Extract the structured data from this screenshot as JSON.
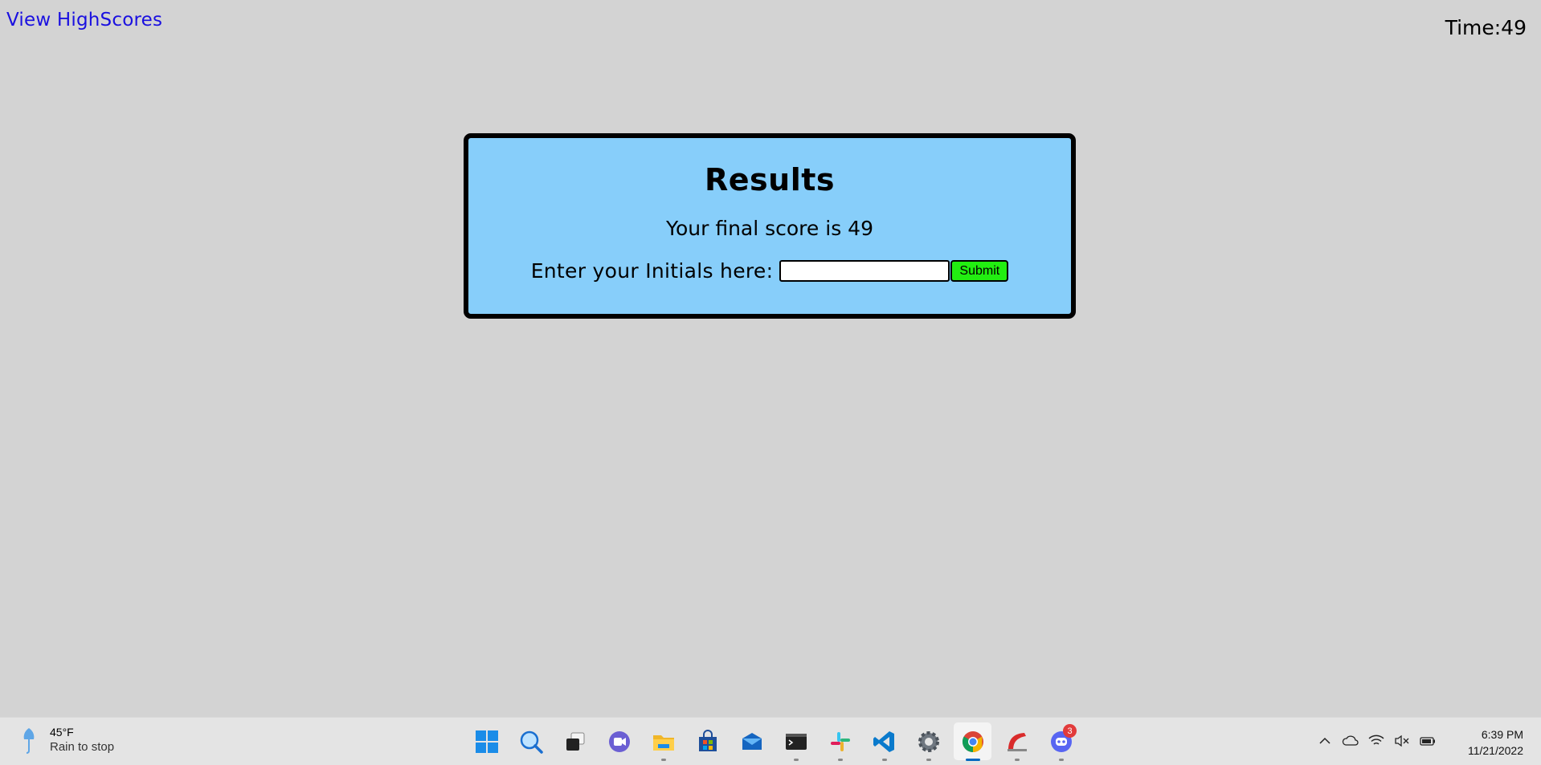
{
  "header": {
    "highscores_link": "View HighScores",
    "timer": "Time:49"
  },
  "results": {
    "title": "Results",
    "final_score_text": "Your final score is 49",
    "initials_label": "Enter your Initials here:",
    "initials_value": "",
    "submit_label": "Submit"
  },
  "taskbar": {
    "weather": {
      "temp": "45°F",
      "desc": "Rain to stop",
      "icon": "umbrella-icon"
    },
    "apps": [
      {
        "name": "start-menu-icon"
      },
      {
        "name": "search-icon"
      },
      {
        "name": "task-view-icon"
      },
      {
        "name": "teams-chat-icon"
      },
      {
        "name": "file-explorer-icon"
      },
      {
        "name": "microsoft-store-icon"
      },
      {
        "name": "mail-icon"
      },
      {
        "name": "terminal-icon"
      },
      {
        "name": "slack-icon"
      },
      {
        "name": "vscode-icon"
      },
      {
        "name": "settings-icon"
      },
      {
        "name": "chrome-icon",
        "active": true
      },
      {
        "name": "app-red-icon"
      },
      {
        "name": "discord-icon",
        "badge": "3"
      }
    ],
    "tray": [
      "chevron-up-icon",
      "onedrive-icon",
      "wifi-icon",
      "volume-muted-icon",
      "battery-icon"
    ],
    "clock": {
      "time": "6:39 PM",
      "date": "11/21/2022"
    }
  },
  "colors": {
    "background": "#d3d3d3",
    "card": "#87cefa",
    "submit": "#22ee11",
    "link": "#1a10e0"
  }
}
